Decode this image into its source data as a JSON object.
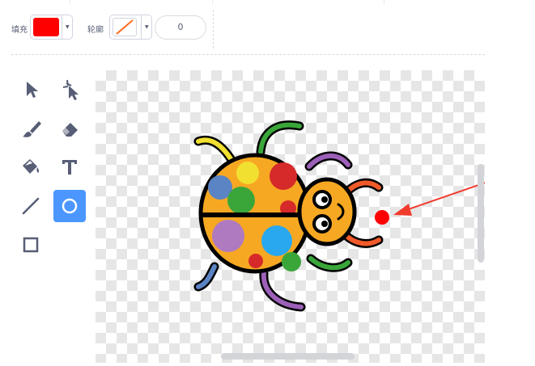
{
  "toolbar": {
    "fill_label": "填充",
    "outline_label": "轮廓",
    "fill_color": "#ff0000",
    "outline_color": "none",
    "outline_width": "0"
  },
  "tools": [
    {
      "icon": "select-arrow-icon",
      "active": false
    },
    {
      "icon": "reshape-icon",
      "active": false
    },
    {
      "icon": "brush-icon",
      "active": false
    },
    {
      "icon": "eraser-icon",
      "active": false
    },
    {
      "icon": "fill-bucket-icon",
      "active": false
    },
    {
      "icon": "text-icon",
      "active": false
    },
    {
      "icon": "line-icon",
      "active": false
    },
    {
      "icon": "circle-icon",
      "active": true
    },
    {
      "icon": "rectangle-icon",
      "active": false
    }
  ],
  "canvas": {
    "sprite": "ladybug",
    "accent_colors": {
      "body": "#f7a823",
      "outline": "#000000",
      "active_tool": "#4c97ff",
      "dot": "#ff0000",
      "annotation_arrow": "#f03c2d"
    }
  }
}
